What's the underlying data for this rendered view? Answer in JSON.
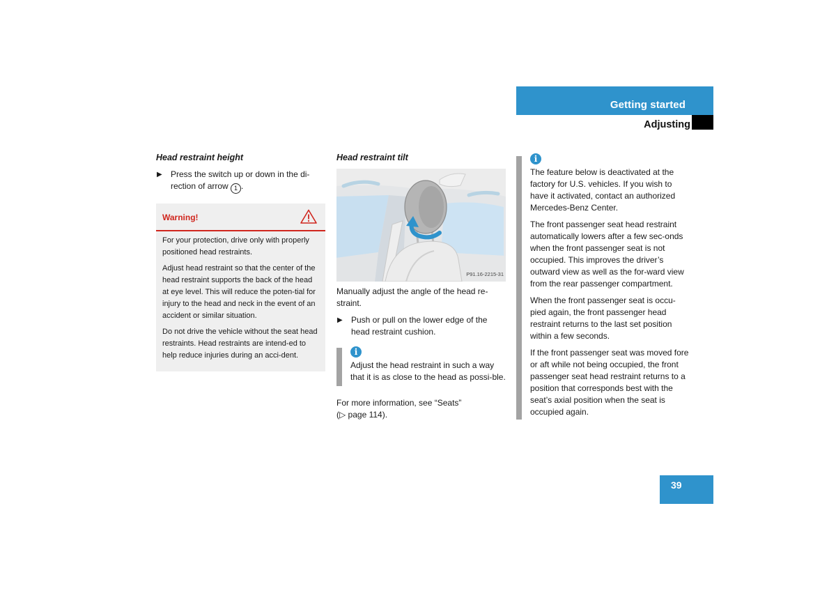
{
  "header": {
    "section": "Getting started",
    "subsection": "Adjusting"
  },
  "col1": {
    "title": "Head restraint height",
    "bullet_text": "Press the switch up or down in the di-rection of arrow",
    "bullet_ref": "1",
    "bullet_end": ".",
    "warning": {
      "title": "Warning!",
      "icon": "warning-triangle-icon",
      "paragraphs": [
        "For your protection, drive only with properly positioned head restraints.",
        "Adjust head restraint so that the center of the head restraint supports the back of the head at eye level. This will reduce the poten-tial for injury to the head and neck in the event of an accident or similar situation.",
        "Do not drive the vehicle without the seat head restraints. Head restraints are intend-ed to help reduce injuries during an acci-dent."
      ]
    }
  },
  "col2": {
    "title": "Head restraint tilt",
    "image_code": "P91.16-2215-31",
    "intro": "Manually adjust the angle of the head re-straint.",
    "bullet_text": "Push or pull on the lower edge of the head restraint cushion.",
    "note": {
      "icon": "info-icon",
      "text": "Adjust the head restraint in such a way that it is as close to the head as possi-ble."
    },
    "more_info": "For more information, see “Seats”",
    "page_ref": "(▷ page 114)."
  },
  "col3": {
    "note": {
      "icon": "info-icon",
      "paragraphs": [
        "The feature below is deactivated at the factory for U.S. vehicles. If you wish to have it activated, contact an authorized Mercedes-Benz Center.",
        "The front passenger seat head restraint automatically lowers after a few sec-onds when the front passenger seat is not occupied. This improves the driver’s outward view as well as the for-ward view from the rear passenger compartment.",
        "When the front passenger seat is occu-pied again, the front passenger head restraint returns to the last set position within a few seconds.",
        "If the front passenger seat was moved fore or aft while not being occupied, the front passenger seat head restraint returns to a position that corresponds best with the seat’s axial position when the seat is occupied again."
      ]
    }
  },
  "footer": {
    "page_number": "39"
  },
  "colors": {
    "accent_blue": "#2f93cc",
    "warning_red": "#d0261e",
    "note_bar_gray": "#a3a3a3",
    "warning_bg": "#efefef"
  }
}
